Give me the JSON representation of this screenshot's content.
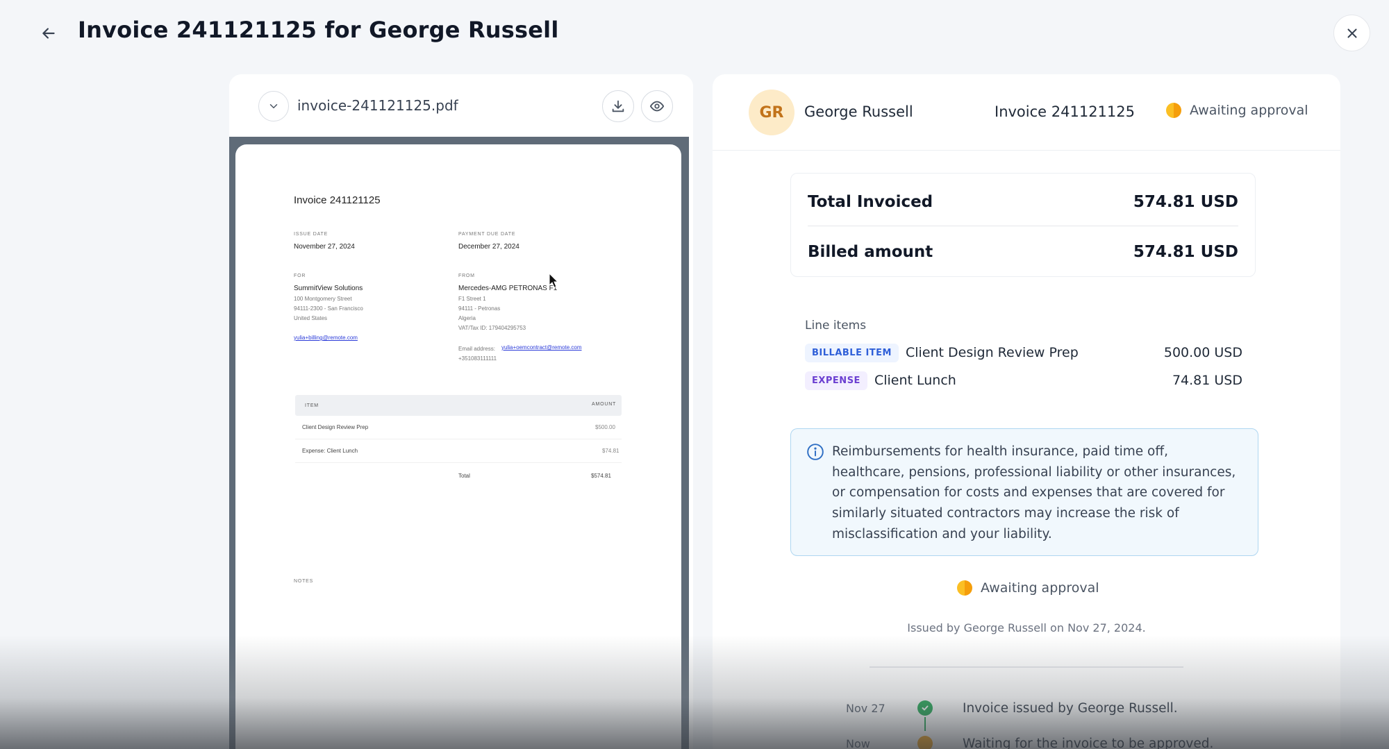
{
  "header": {
    "title": "Invoice 241121125 for George Russell"
  },
  "pdf": {
    "filename": "invoice-241121125.pdf",
    "page": {
      "title": "Invoice 241121125",
      "issue_date_label": "ISSUE DATE",
      "issue_date": "November 27, 2024",
      "due_date_label": "PAYMENT DUE DATE",
      "due_date": "December 27, 2024",
      "for_label": "FOR",
      "for_name": "SummitView Solutions",
      "for_addr1": "100 Montgomery Street",
      "for_addr2": "94111-2300 - San Francisco",
      "for_addr3": "United States",
      "for_email": "yulia+billing@remote.com",
      "from_label": "FROM",
      "from_name": "Mercedes-AMG PETRONAS F1",
      "from_addr1": "F1 Street 1",
      "from_addr2": "94111 - Petronas",
      "from_addr3": "Algeria",
      "from_vat": "VAT/Tax ID: 179404295753",
      "from_email_label": "Email address:",
      "from_email": "yulia+oemcontract@remote.com",
      "from_phone": "+351083111111",
      "table_item_header": "ITEM",
      "table_amount_header": "AMOUNT",
      "rows": [
        {
          "item": "Client Design Review Prep",
          "amount": "$500.00"
        },
        {
          "item": "Expense: Client Lunch",
          "amount": "$74.81"
        }
      ],
      "total_label": "Total",
      "total_value": "$574.81",
      "notes_label": "NOTES"
    }
  },
  "detail": {
    "avatar_initials": "GR",
    "name": "George Russell",
    "invoice_label": "Invoice 241121125",
    "status": "Awaiting approval",
    "totals": {
      "invoiced_label": "Total Invoiced",
      "invoiced_value": "574.81 USD",
      "billed_label": "Billed amount",
      "billed_value": "574.81 USD"
    },
    "line_items_label": "Line items",
    "line_items": [
      {
        "badge": "BILLABLE ITEM",
        "name": "Client Design Review Prep",
        "amount": "500.00 USD"
      },
      {
        "badge": "EXPENSE",
        "name": "Client Lunch",
        "amount": "74.81 USD"
      }
    ],
    "info_text": "Reimbursements for health insurance, paid time off, healthcare, pensions, professional liability or other insurances, or compensation for costs and expenses that are covered for similarly situated contractors may increase the risk of misclassification and your liability.",
    "status_bottom": "Awaiting approval",
    "issued_by": "Issued by George Russell on Nov 27, 2024.",
    "timeline": [
      {
        "date": "Nov 27",
        "text": "Invoice issued by George Russell."
      },
      {
        "date": "Now",
        "text": "Waiting for the invoice to be approved."
      }
    ]
  },
  "colors": {
    "status_orange": "#f59e0b",
    "success_green": "#16a34a",
    "info_border": "#aed6f1"
  },
  "icons": [
    "arrow-left-icon",
    "close-icon",
    "chevron-down-icon",
    "download-icon",
    "eye-icon",
    "info-icon",
    "check-icon",
    "mouse-cursor-icon"
  ]
}
